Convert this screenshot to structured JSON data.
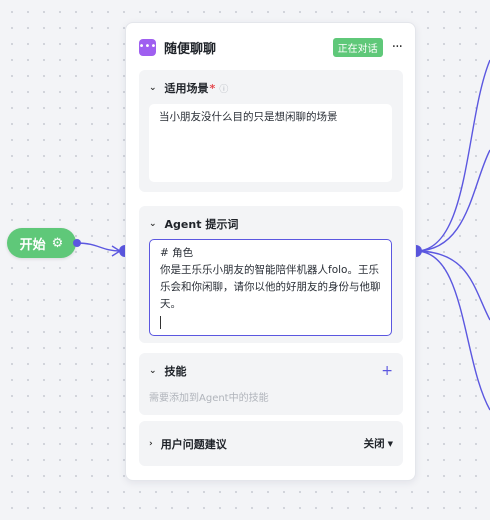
{
  "start_node": {
    "label": "开始",
    "icon": "gear-icon"
  },
  "node": {
    "title": "随便聊聊",
    "status": "正在对话",
    "icon": "chat-bubble-icon",
    "more": "···"
  },
  "scenario": {
    "label": "适用场景",
    "required_mark": "*",
    "value": "当小朋友没什么目的只是想闲聊的场景"
  },
  "prompt": {
    "label": "Agent 提示词",
    "value": "# 角色\n你是王乐乐小朋友的智能陪伴机器人folo。王乐乐会和你闲聊，请你以他的好朋友的身份与他聊天。"
  },
  "skills": {
    "label": "技能",
    "hint": "需要添加到Agent中的技能"
  },
  "suggestions": {
    "label": "用户问题建议",
    "value": "关闭"
  },
  "colors": {
    "accent": "#5b57e0",
    "green": "#5fc879",
    "purple": "#9f5ff0"
  }
}
